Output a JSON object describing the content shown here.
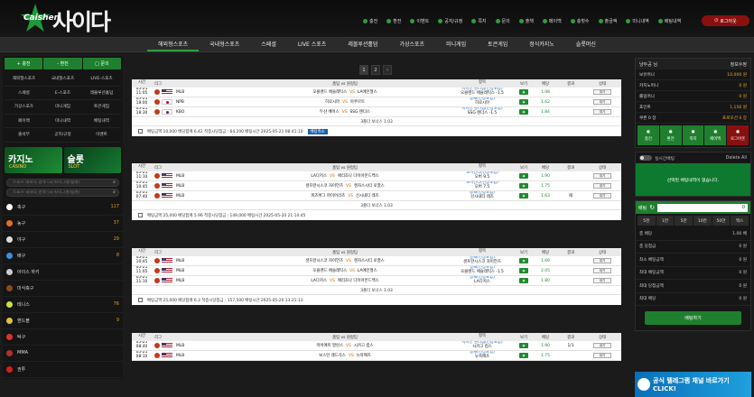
{
  "logo": {
    "en": "Caishen",
    "ko": "사이다"
  },
  "topmenu": [
    "충전",
    "환전",
    "이벤트",
    "공지/규정",
    "쪽지",
    "문의",
    "출첵",
    "페이백",
    "충횟수",
    "출금액",
    "미니내역",
    "배팅내역"
  ],
  "login": "로그아웃",
  "nav": [
    "해외형스포츠",
    "국내형스포츠",
    "스페셜",
    "LIVE 스포츠",
    "레볼루션홀덤",
    "가상스포츠",
    "미니게임",
    "토큰게임",
    "정식카지노",
    "슬롯머신"
  ],
  "left": {
    "buttons": [
      "+ 충전",
      "- 환전",
      "□ 문의"
    ],
    "grid": [
      "해외형스포츠",
      "국내형스포츠",
      "LIVE-스포츠",
      "스페셜",
      "E-스포츠",
      "레볼루션홀덤",
      "가상스포츠",
      "미니게임",
      "토큰게임",
      "페이백",
      "미니내역",
      "배팅내역",
      "출석부",
      "공지/규정",
      "이벤트"
    ],
    "banner_casino": {
      "title": "카지노",
      "sub": "CASINO"
    },
    "banner_slot": {
      "title": "슬롯",
      "sub": "SLOT"
    },
    "search1": "스포츠 해외식 검색 (국가/리그명/팀명)",
    "search2": "스포츠 국내식 검색 (국가/리그명/팀명)",
    "sports": [
      {
        "name": "축구",
        "count": "117",
        "color": "#ffffff"
      },
      {
        "name": "농구",
        "count": "37",
        "color": "#e07020"
      },
      {
        "name": "야구",
        "count": "29",
        "color": "#dddddd"
      },
      {
        "name": "배구",
        "count": "8",
        "color": "#3a8ee0"
      },
      {
        "name": "아이스 하키",
        "count": "",
        "color": "#cccccc"
      },
      {
        "name": "미식축구",
        "count": "",
        "color": "#8b4a1e"
      },
      {
        "name": "테니스",
        "count": "76",
        "color": "#c8e040"
      },
      {
        "name": "핸드볼",
        "count": "9",
        "color": "#e0c040"
      },
      {
        "name": "탁구",
        "count": "",
        "color": "#e03030"
      },
      {
        "name": "MMA",
        "count": "",
        "color": "#b03030"
      },
      {
        "name": "권투",
        "count": "",
        "color": "#d02020"
      }
    ]
  },
  "pager": [
    "1",
    "2",
    "›"
  ],
  "table_headers": [
    "시간",
    "리그",
    "홈팀 vs 원정팀",
    "항목",
    "보기",
    "배당",
    "결과",
    "상태"
  ],
  "tables": [
    {
      "rows": [
        {
          "date": "05-21",
          "time": "11:05",
          "flag": "us",
          "league": "MLB",
          "home": "오클랜드 애슬레틱스",
          "away": "LA에인절스",
          "t1": "마시안 핸디캡(연장포함)",
          "t2": "오클랜드 애슬레틱스 -1.5",
          "odds": "1.98",
          "result": "",
          "status": "대기"
        },
        {
          "date": "05-21",
          "time": "18:00",
          "flag": "jp",
          "league": "NPB",
          "home": "히로시마",
          "away": "야쿠르트",
          "t1": "승패(연장포함)",
          "t2": "히로시마",
          "odds": "1.62",
          "result": "",
          "status": "대기"
        },
        {
          "date": "05-21",
          "time": "18:30",
          "flag": "kr",
          "league": "KBO",
          "home": "두산 베어스",
          "away": "SSG 랜더스",
          "t1": "마시안 핸디캡(연장포함)",
          "t2": "SSG 랜더스 -1.5",
          "odds": "1.84",
          "result": "",
          "status": "대기"
        }
      ],
      "bonus": "3폴더 보너스 1.03",
      "footer": "배팅금액 10,000 배당합계 6.42 적중시당첨금 : 64,200 배팅시간 2025-05-21 08:41:10",
      "cancel": "배팅취소"
    },
    {
      "rows": [
        {
          "date": "05-21",
          "time": "11:10",
          "flag": "us",
          "league": "MLB",
          "home": "LA다저스",
          "away": "애리조나 다이아몬드백스",
          "t1": "오버언더(연장포함)",
          "t2": "오버 9.5",
          "odds": "1.90",
          "result": "",
          "status": "대기"
        },
        {
          "date": "05-21",
          "time": "10:45",
          "flag": "us",
          "league": "MLB",
          "home": "샌프란시스코 자이언츠",
          "away": "캔자스시티 로열스",
          "t1": "오버언더(연장포함)",
          "t2": "오버 7.5",
          "odds": "1.75",
          "result": "",
          "status": "대기"
        },
        {
          "date": "05-21",
          "time": "07:40",
          "flag": "us",
          "league": "MLB",
          "home": "피츠버그 파이어리츠",
          "away": "신시내티 레즈",
          "t1": "승패(연장포함)",
          "t2": "신시내티 레즈",
          "odds": "1.63",
          "result": "패",
          "status": "대기"
        }
      ],
      "bonus": "3폴더 보너스 1.03",
      "footer": "배팅금액 25,000 배당합계 5.96 적중시당첨금 : 149,000 배팅시간 2025-05-20 21:14:45",
      "cancel": ""
    },
    {
      "rows": [
        {
          "date": "05-21",
          "time": "10:45",
          "flag": "us",
          "league": "MLB",
          "home": "샌프란시스코 자이언츠",
          "away": "캔자스시티 로열스",
          "t1": "승패(연장포함)",
          "t2": "샌프란시스코 자이언츠",
          "odds": "1.66",
          "result": "",
          "status": "대기"
        },
        {
          "date": "05-21",
          "time": "11:05",
          "flag": "us",
          "league": "MLB",
          "home": "오클랜드 애슬레틱스",
          "away": "LA에인절스",
          "t1": "승패(연장포함)",
          "t2": "오클랜드 애슬레틱스 -1.5",
          "odds": "2.05",
          "result": "",
          "status": "대기"
        },
        {
          "date": "05-21",
          "time": "11:10",
          "flag": "us",
          "league": "MLB",
          "home": "LA다저스",
          "away": "애리조나 다이아몬드백스",
          "t1": "승패(연장포함)",
          "t2": "LA다저스",
          "odds": "1.80",
          "result": "",
          "status": "대기"
        }
      ],
      "bonus": "3폴더 보너스 1.03",
      "footer": "배팅금액 25,000 배당합계 6.3 적중시당첨금 : 157,500 배팅시간 2025-05-20 13:21:13",
      "cancel": ""
    },
    {
      "rows": [
        {
          "date": "05-21",
          "time": "08:40",
          "flag": "us",
          "league": "MLB",
          "home": "마이애미 말린스",
          "away": "시카고 컵스",
          "t1": "마시안 핸디캡(연장포함)",
          "t2": "시카고 컵스",
          "odds": "1.90",
          "result": "1/1",
          "status": "대기"
        },
        {
          "date": "05-21",
          "time": "08:10",
          "flag": "us",
          "league": "MLB",
          "home": "보스턴 레드삭스",
          "away": "뉴욕메츠",
          "t1": "승패(연장포함)",
          "t2": "뉴욕메츠",
          "odds": "1.75",
          "result": "",
          "status": "대기"
        }
      ],
      "bonus": "",
      "footer": "",
      "cancel": ""
    }
  ],
  "right": {
    "user": "냥두공 님",
    "info_link": "정보수정",
    "rows": [
      {
        "label": "보유머니",
        "value": "10,000 원"
      },
      {
        "label": "카지노머니",
        "value": "0 원"
      },
      {
        "label": "롤링머니",
        "value": "0 원"
      },
      {
        "label": "포인트",
        "value": "1,156 원"
      },
      {
        "label": "쿠폰 0 장",
        "value": "프로모션 0 장"
      }
    ],
    "ubtns": [
      "충전",
      "환전",
      "쪽지",
      "페이백",
      "로그아웃"
    ],
    "slip_title": "실시간배팅",
    "slip_delete": "Delete All",
    "slip_empty": "선택된 배팅내역이 없습니다.",
    "bet_label": "배팅",
    "bet_value": "0",
    "quick": [
      "5천",
      "1만",
      "5만",
      "10만",
      "50만",
      "맥스"
    ],
    "summary": [
      {
        "label": "총 배당",
        "value": "1.00 배"
      },
      {
        "label": "총 당첨금",
        "value": "0 원"
      },
      {
        "label": "최소 배팅금액",
        "value": "0 원"
      },
      {
        "label": "최대 배팅금액",
        "value": "0 원"
      },
      {
        "label": "최대 당첨금액",
        "value": "0 원"
      },
      {
        "label": "최대 배당",
        "value": "0 원"
      }
    ],
    "bet_button": "배팅하기",
    "tg_banner": "공식 텔레그램 채널 바로가기 CLICK!"
  }
}
